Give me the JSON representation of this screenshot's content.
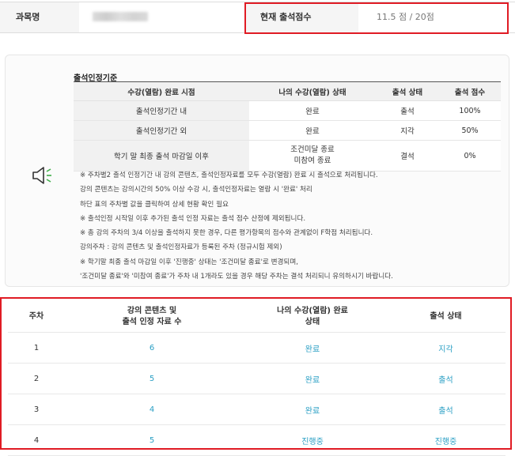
{
  "course_info": {
    "course_name_label": "과목명",
    "course_name_value": "",
    "score_label": "현재 출석점수",
    "score_value": "11.5 점 / 20점"
  },
  "criteria": {
    "title": "출석인정기준",
    "headers": [
      "수강(열람) 완료 시점",
      "나의 수강(열람) 상태",
      "출석 상태",
      "출석 점수"
    ],
    "rows": [
      {
        "period": "출석인정기간 내",
        "status_line1": "완료",
        "status_line2": "",
        "attendance": "출석",
        "score": "100%"
      },
      {
        "period": "출석인정기간 외",
        "status_line1": "완료",
        "status_line2": "",
        "attendance": "지각",
        "score": "50%"
      },
      {
        "period": "학기 말 최종 출석 마감일 이후",
        "status_line1": "조건미달 종료",
        "status_line2": "미참여 종료",
        "attendance": "결석",
        "score": "0%"
      }
    ],
    "notes": [
      "※ 주차별2 출석 인정기간 내 강의 콘텐츠, 출석인정자료를 모두 수강(열람) 완료 시 출석으로 처리됩니다.",
      "  강의 콘텐츠는 강의시간의 50% 이상 수강 시, 출석인정자료는 열람 시 '완료' 처리",
      "  하단 표의 주차별 값을 클릭하여 상세 현황 확인 필요",
      "※ 출석인정 시작일 이후 추가된 출석 인정 자료는 출석 점수 산정에 제외됩니다.",
      "※ 총 강의 주차의 3/4 이상을 출석하지 못한 경우, 다른 평가항목의 점수와 관계없이 F학점 처리됩니다.",
      "  강의주차 : 강의 콘텐츠 및 출석인정자료가 등록된 주차 (정규시험 제외)",
      "※ 학기말 최종 출석 마감일 이후 '진행중' 상태는 '조건미달 종료'로 변경되며,",
      "  '조건미달 종료'와 '미참여 종료'가 주차 내 1개라도 있을 경우 해당 주차는 결석 처리되니 유의하시기 바랍니다."
    ]
  },
  "weeks_table": {
    "headers": {
      "week": "주차",
      "content_line1": "강의 콘텐츠 및",
      "content_line2": "출석 인정 자료 수",
      "status_line1": "나의 수강(열람) 완료",
      "status_line2": "상태",
      "attendance": "출석 상태"
    },
    "rows": [
      {
        "week": "1",
        "count": "6",
        "status": "완료",
        "attendance": "지각"
      },
      {
        "week": "2",
        "count": "5",
        "status": "완료",
        "attendance": "출석"
      },
      {
        "week": "3",
        "count": "4",
        "status": "완료",
        "attendance": "출석"
      },
      {
        "week": "4",
        "count": "5",
        "status": "진행중",
        "attendance": "진행중"
      }
    ]
  },
  "colors": {
    "highlight_border": "#e01b24",
    "link": "#2a9fc4",
    "speaker_icon": "#333333",
    "speaker_waves": "#3fae49"
  },
  "icons": {
    "speaker": "speaker-icon"
  }
}
